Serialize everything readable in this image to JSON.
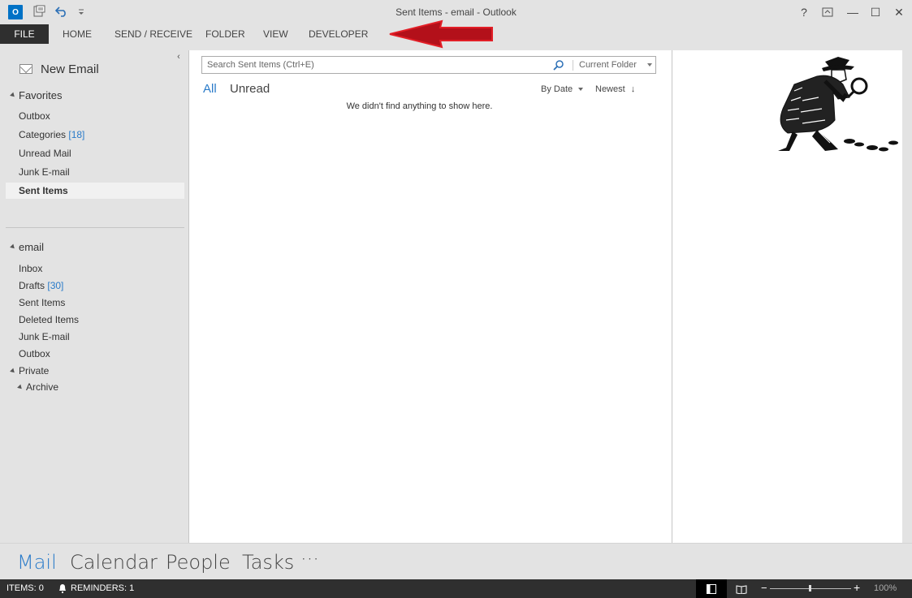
{
  "window": {
    "title": "Sent Items - email - Outlook",
    "app_icon": "outlook-logo",
    "logo_text": "O"
  },
  "quick_access": {
    "send_receive_icon": "send-receive-all-icon",
    "undo_icon": "undo-icon",
    "customize_icon": "chevron-down-icon"
  },
  "window_controls": {
    "help": "?",
    "restore_ribbon": "⊡",
    "minimize": "—",
    "maximize": "☐",
    "close": "✕"
  },
  "ribbon": {
    "tabs": [
      "FILE",
      "HOME",
      "SEND / RECEIVE",
      "FOLDER",
      "VIEW",
      "DEVELOPER"
    ]
  },
  "annotation": {
    "arrow_color": "#e21e26"
  },
  "nav": {
    "new_email": "New Email",
    "collapse_glyph": "‹",
    "favorites": {
      "label": "Favorites",
      "items": [
        {
          "label": "Outbox",
          "count": ""
        },
        {
          "label": "Categories",
          "count": "[18]"
        },
        {
          "label": "Unread Mail",
          "count": ""
        },
        {
          "label": "Junk E-mail",
          "count": ""
        },
        {
          "label": "Sent Items",
          "count": ""
        }
      ]
    },
    "account": {
      "label": "email",
      "items": [
        {
          "label": "Inbox",
          "count": ""
        },
        {
          "label": "Drafts",
          "count": "[30]"
        },
        {
          "label": "Sent Items",
          "count": ""
        },
        {
          "label": "Deleted Items",
          "count": ""
        },
        {
          "label": "Junk E-mail",
          "count": ""
        },
        {
          "label": "Outbox",
          "count": ""
        }
      ]
    },
    "private": {
      "label": "Private",
      "archive": "Archive"
    }
  },
  "list": {
    "search_placeholder": "Search Sent Items (Ctrl+E)",
    "search_scope": "Current Folder",
    "filter_all": "All",
    "filter_unread": "Unread",
    "sort_by": "By Date",
    "sort_order": "Newest",
    "empty_message": "We didn't find anything to show here."
  },
  "bottom_nav": {
    "mail": "Mail",
    "calendar": "Calendar",
    "people": "People",
    "tasks": "Tasks",
    "more": "···"
  },
  "status": {
    "items": "ITEMS: 0",
    "reminders": "REMINDERS: 1",
    "zoom": "100%"
  },
  "colors": {
    "accent": "#2a7bc9",
    "file_tab": "#2f2f2f",
    "status_bar": "#2f2f2f"
  }
}
